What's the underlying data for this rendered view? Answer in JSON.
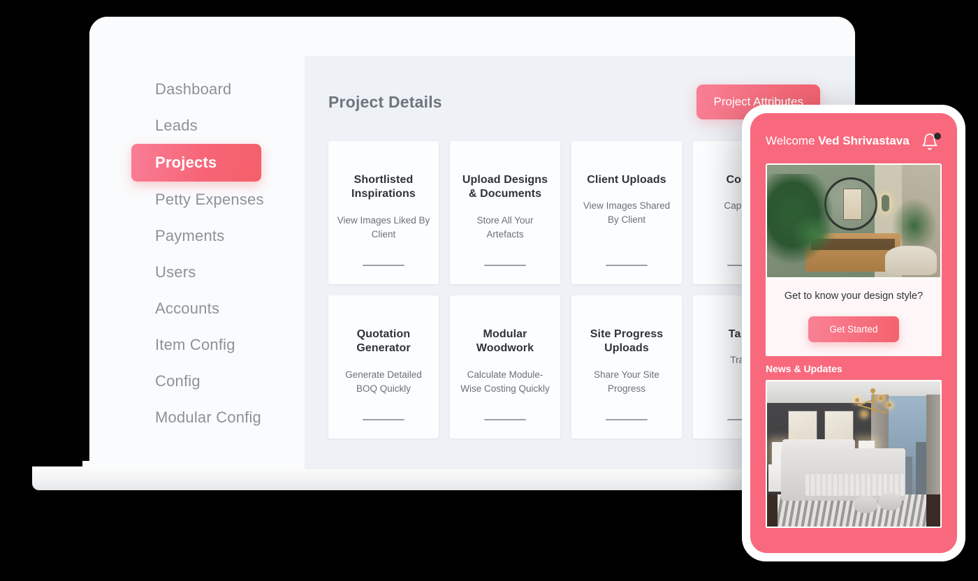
{
  "sidebar": {
    "items": [
      {
        "label": "Dashboard",
        "active": false
      },
      {
        "label": "Leads",
        "active": false
      },
      {
        "label": "Projects",
        "active": true
      },
      {
        "label": "Petty Expenses",
        "active": false
      },
      {
        "label": "Payments",
        "active": false
      },
      {
        "label": "Users",
        "active": false
      },
      {
        "label": "Accounts",
        "active": false
      },
      {
        "label": "Item Config",
        "active": false
      },
      {
        "label": "Config",
        "active": false
      },
      {
        "label": "Modular Config",
        "active": false
      }
    ]
  },
  "main": {
    "page_title": "Project Details",
    "attributes_button": "Project Attributes",
    "cards": [
      {
        "title": "Shortlisted Inspirations",
        "subtitle": "View Images Liked By Client"
      },
      {
        "title": "Upload Designs & Documents",
        "subtitle": "Store All Your Artefacts"
      },
      {
        "title": "Client Uploads",
        "subtitle": "View Images Shared By Client"
      },
      {
        "title": "Con Pro",
        "subtitle": "Capture De"
      },
      {
        "title": "Quotation Generator",
        "subtitle": "Generate Detailed BOQ Quickly"
      },
      {
        "title": "Modular Woodwork",
        "subtitle": "Calculate Module-Wise Costing Quickly"
      },
      {
        "title": "Site Progress Uploads",
        "subtitle": "Share Your Site Progress"
      },
      {
        "title": "Ta Plan",
        "subtitle": "Trac Pro"
      }
    ]
  },
  "phone": {
    "welcome_prefix": "Welcome ",
    "user_name": "Ved Shrivastava",
    "style_prompt": "Get to know your design style?",
    "get_started_button": "Get Started",
    "news_label": "News & Updates"
  },
  "colors": {
    "accent_pink": "#f8697d",
    "accent_coral": "#f4606a",
    "accent_light_pink": "#f97e96",
    "panel_bg": "#eef1f6",
    "app_bg": "#fafbfc",
    "nav_text": "#8d9299",
    "title_text": "#6f757d",
    "card_title_text": "#2f3338",
    "card_sub_text": "#6b7077"
  }
}
